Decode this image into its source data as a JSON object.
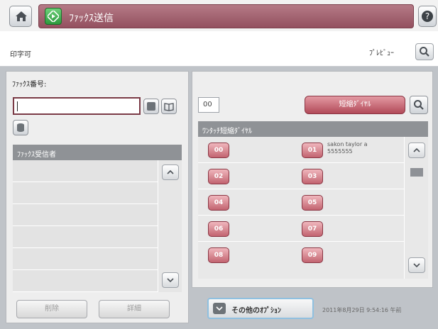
{
  "header": {
    "title": "ﾌｧｯｸｽ送信",
    "icons": {
      "home": "home-icon",
      "app": "fax-start-icon",
      "help": "help-icon"
    }
  },
  "status": {
    "message": "印字可",
    "preview_label": "ﾌﾟﾚﾋﾞｭｰ"
  },
  "fax_number": {
    "label": "ﾌｧｯｸｽ番号:",
    "value": ""
  },
  "recipients": {
    "header": "ﾌｧｯｸｽ受信者",
    "rows": [
      "",
      "",
      "",
      "",
      "",
      ""
    ],
    "delete_label": "削除",
    "details_label": "詳細"
  },
  "speed_dial": {
    "code_value": "00",
    "button_label": "短縮ﾀﾞｲﾔﾙ",
    "onetouch_header": "ﾜﾝﾀｯﾁ短縮ﾀﾞｲﾔﾙ",
    "items": [
      {
        "code": "00",
        "name": "",
        "number": ""
      },
      {
        "code": "01",
        "name": "sakon taylor a",
        "number": "5555555"
      },
      {
        "code": "02",
        "name": "",
        "number": ""
      },
      {
        "code": "03",
        "name": "",
        "number": ""
      },
      {
        "code": "04",
        "name": "",
        "number": ""
      },
      {
        "code": "05",
        "name": "",
        "number": ""
      },
      {
        "code": "06",
        "name": "",
        "number": ""
      },
      {
        "code": "07",
        "name": "",
        "number": ""
      },
      {
        "code": "08",
        "name": "",
        "number": ""
      },
      {
        "code": "09",
        "name": "",
        "number": ""
      }
    ]
  },
  "footer": {
    "options_label": "その他のｵﾌﾟｼｮﾝ",
    "datetime": "2011年8月29日 9:54:16 午前"
  },
  "colors": {
    "title_banner": "#93505f",
    "speed_button": "#b24a58",
    "header_bar": "#8f9296"
  }
}
